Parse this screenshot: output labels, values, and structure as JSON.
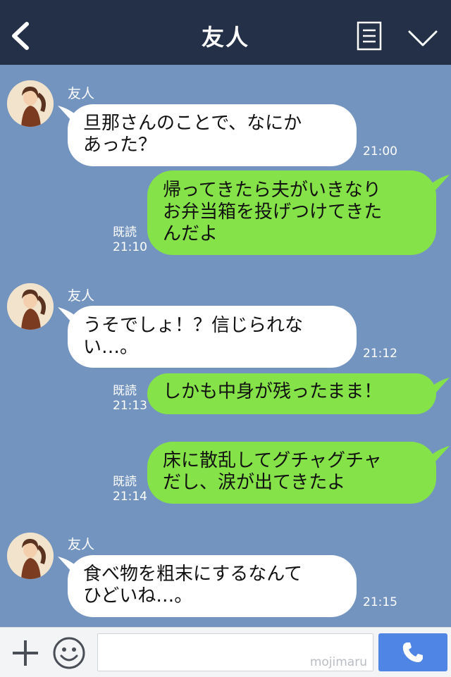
{
  "header": {
    "title": "友人",
    "back_icon": "chevron-left-icon",
    "menu_icon": "menu-list-icon",
    "expand_icon": "chevron-down-icon",
    "background": "#243047"
  },
  "chat": {
    "background": "#7494c0",
    "messages": [
      {
        "side": "left",
        "sender": "友人",
        "lines": [
          "旦那さんのことで、なにか",
          "あった？"
        ],
        "time": "21:00"
      },
      {
        "side": "right",
        "read": "既読",
        "lines": [
          "帰ってきたら夫がいきなり",
          "お弁当箱を投げつけてきた",
          "んだよ"
        ],
        "time": "21:10"
      },
      {
        "side": "left",
        "sender": "友人",
        "lines": [
          "うそでしょ！？信じられな",
          "い…。"
        ],
        "time": "21:12"
      },
      {
        "side": "right",
        "read": "既読",
        "lines": [
          "しかも中身が残ったまま！"
        ],
        "time": "21:13"
      },
      {
        "side": "right",
        "read": "既読",
        "lines": [
          "床に散乱してグチャグチャ",
          "だし、涙が出てきたよ"
        ],
        "time": "21:14"
      },
      {
        "side": "left",
        "sender": "友人",
        "lines": [
          "食べ物を粗末にするなんて",
          "ひどいね…。"
        ],
        "time": "21:15"
      }
    ],
    "bubble_colors": {
      "left": "#ffffff",
      "right": "#85e249"
    }
  },
  "footer": {
    "plus_icon": "plus-icon",
    "emoji_icon": "smiley-icon",
    "input_value": "",
    "watermark": "mojimaru",
    "call_icon": "phone-icon",
    "call_color": "#4f86e6"
  }
}
